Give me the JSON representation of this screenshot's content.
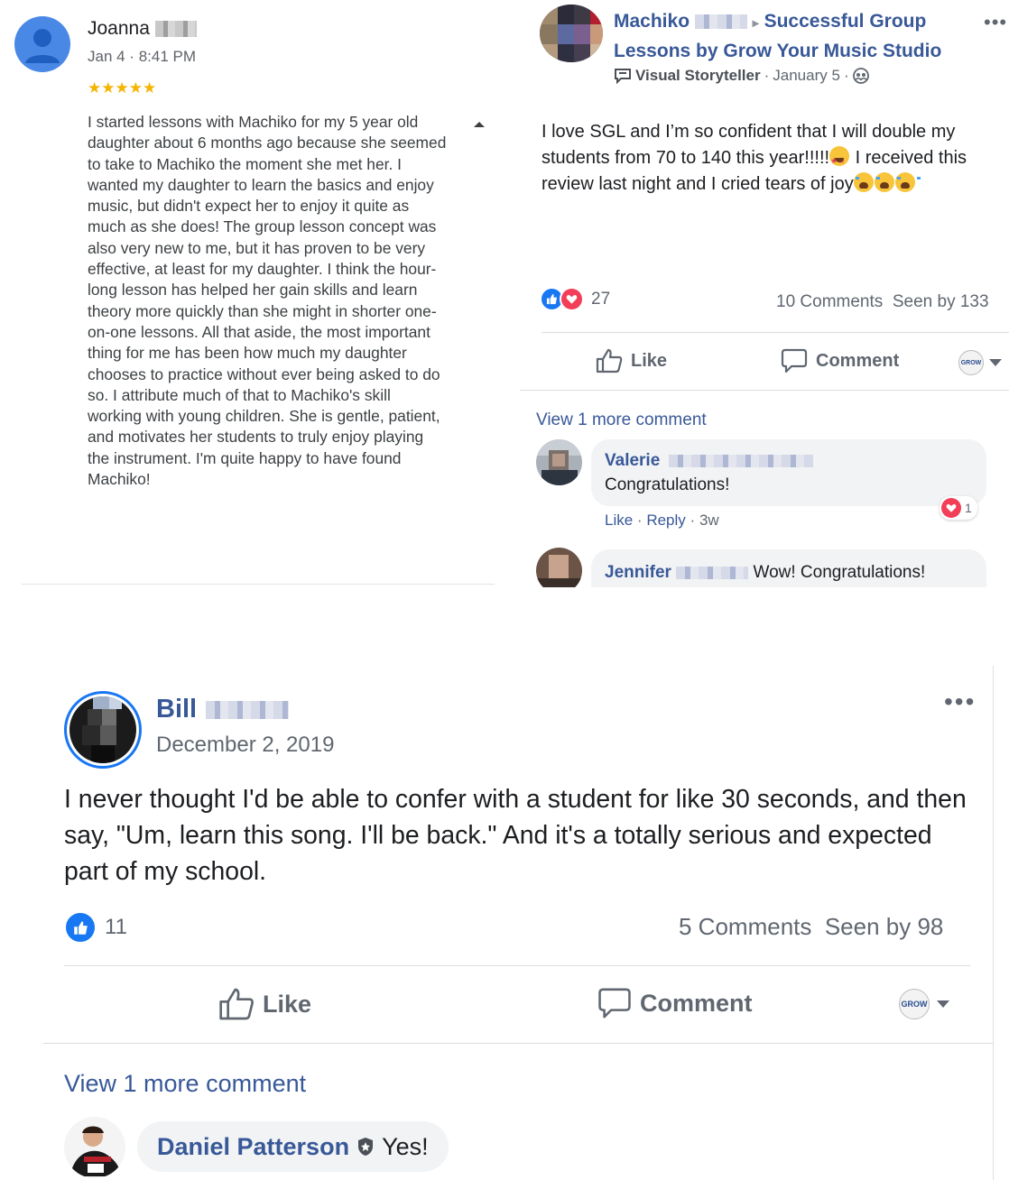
{
  "google_review": {
    "reviewer_first_name": "Joanna",
    "date": "Jan 4 · 8:41 PM",
    "stars": "★★★★★",
    "text": "I started lessons with Machiko for my 5 year old daughter about 6 months ago because she seemed to take to Machiko the moment she met her. I wanted my daughter to learn the basics and enjoy music, but didn't expect her to enjoy it quite as much as she does! The group lesson concept was also very new to me, but it has proven to be very effective, at least for my daughter. I think the hour-long lesson has helped her gain skills and learn theory more quickly than she might in shorter one-on-one lessons. All that aside, the most important thing for me has been how much my daughter chooses to practice without ever being asked to do so. I attribute much of that to Machiko's skill working with young children. She is gentle, patient, and motivates her students to truly enjoy playing the instrument. I'm quite happy to have found Machiko!"
  },
  "post1": {
    "author_first_name": "Machiko",
    "arrow": "▸",
    "group_name": "Successful Group Lessons by Grow Your Music Studio",
    "badge": "Visual Storyteller",
    "date": "January 5",
    "sep": "·",
    "more": "•••",
    "text_part1": "I love SGL and I’m so confident that I will double my students from 70 to 140 this year!!!!!",
    "text_part2": " I received this review last night and I cried tears of joy",
    "reaction_count": "27",
    "comments_count": "10 Comments",
    "seen_by": "Seen by 133",
    "like_label": "Like",
    "comment_label": "Comment",
    "grow_badge": "GROW",
    "view_more": "View 1 more comment",
    "comments": [
      {
        "name": "Valerie",
        "text": "Congratulations!",
        "like": "Like",
        "reply": "Reply",
        "age": "3w",
        "reaction_count": "1"
      },
      {
        "name": "Jennifer",
        "text": "Wow! Congratulations!"
      }
    ]
  },
  "post2": {
    "author_first_name": "Bill",
    "date": "December 2, 2019",
    "more": "•••",
    "text": "I never thought I'd be able to confer with a student for like 30 seconds, and then say, \"Um, learn this song. I'll be back.\" And it's a totally serious and expected part of my school.",
    "like_count": "11",
    "comments_count": "5 Comments",
    "seen_by": "Seen by 98",
    "like_label": "Like",
    "comment_label": "Comment",
    "grow_badge": "GROW",
    "view_more": "View 1 more comment",
    "comment": {
      "name": "Daniel Patterson",
      "text": "Yes!"
    }
  },
  "colors": {
    "fb_link_blue": "#385898",
    "fb_like_blue": "#1877f2",
    "love_red": "#f33e58",
    "star_gold": "#f5b400",
    "google_avatar_blue": "#4a88e6"
  }
}
